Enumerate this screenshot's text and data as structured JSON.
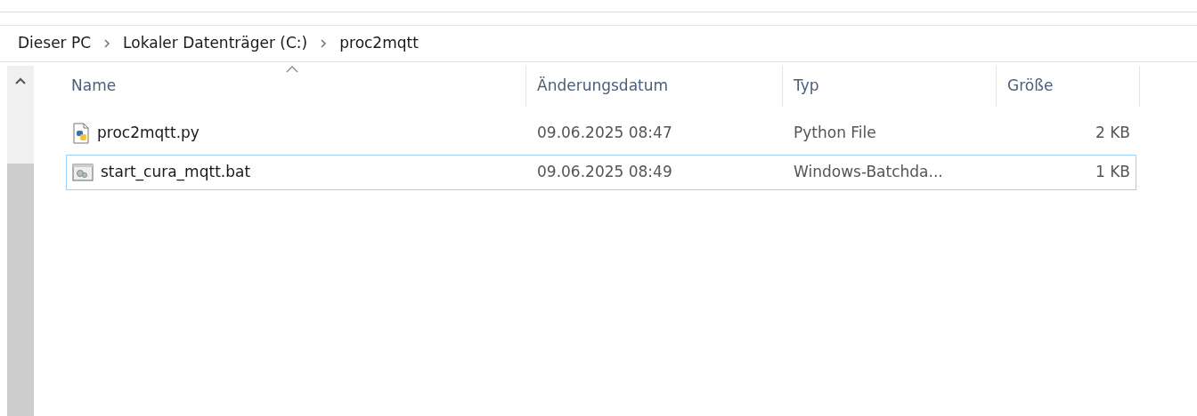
{
  "breadcrumb": [
    "Dieser PC",
    "Lokaler Datenträger (C:)",
    "proc2mqtt"
  ],
  "table": {
    "columns": [
      {
        "label": "Name",
        "sorted": true
      },
      {
        "label": "Änderungsdatum",
        "sorted": false
      },
      {
        "label": "Typ",
        "sorted": false
      },
      {
        "label": "Größe",
        "sorted": false
      }
    ],
    "rows": [
      {
        "kind": "python",
        "name": "proc2mqtt.py",
        "date": "09.06.2025 08:47",
        "type": "Python File",
        "size": "2 KB",
        "focused": false
      },
      {
        "kind": "batch",
        "name": "start_cura_mqtt.bat",
        "date": "09.06.2025 08:49",
        "type": "Windows-Batchda...",
        "size": "1 KB",
        "focused": true
      }
    ]
  }
}
